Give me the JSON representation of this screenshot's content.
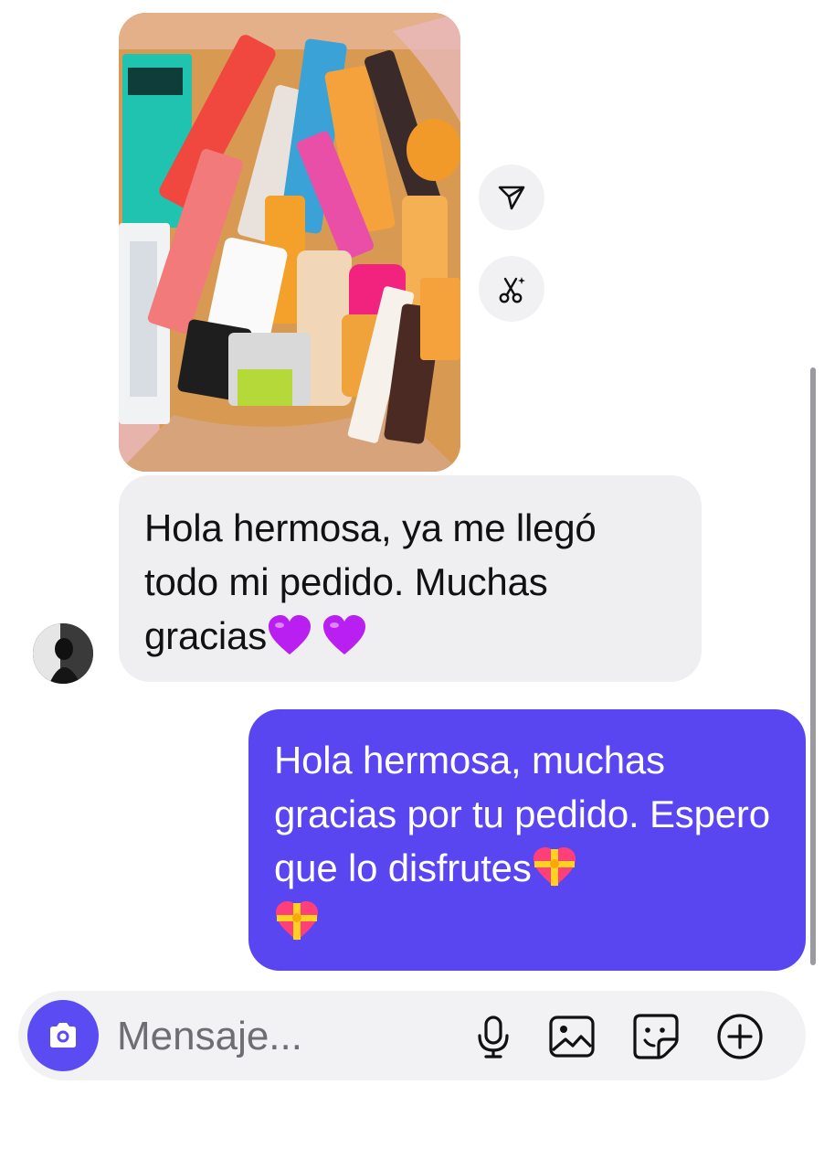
{
  "thread": {
    "photo": {
      "description_icon": "shared-photo",
      "colors": {
        "box": "#d89a52",
        "wrap": "#e8b7b8"
      }
    },
    "actions": [
      {
        "icon": "send-icon"
      },
      {
        "icon": "remix-scissors-icon"
      }
    ],
    "received": {
      "text": "Hola hermosa, ya me llegó todo mi pedido. Muchas gracias",
      "emoji": [
        "purple-heart",
        "purple-heart"
      ],
      "bubble_color": "#efeff2"
    },
    "sent": {
      "text": "Hola hermosa, muchas gracias por tu pedido. Espero que lo disfrutes",
      "emoji": [
        "heart-with-ribbon",
        "heart-with-ribbon"
      ],
      "bubble_color": "#5a46f0"
    }
  },
  "composer": {
    "placeholder": "Mensaje...",
    "icons": [
      "camera-icon",
      "microphone-icon",
      "gallery-icon",
      "sticker-icon",
      "plus-circle-icon"
    ],
    "accent": "#5b4bf2"
  }
}
